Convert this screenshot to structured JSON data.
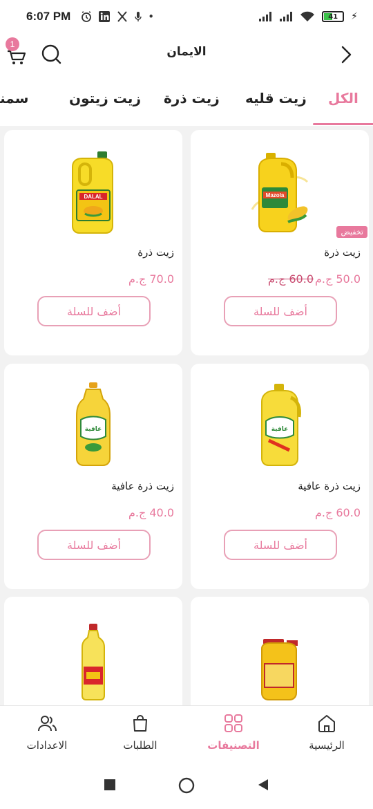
{
  "status_bar": {
    "time": "6:07 PM",
    "battery": "41",
    "left_icons": [
      "alarm-icon",
      "linkedin-icon",
      "restaurant-icon",
      "mic-icon",
      "dot-icon"
    ],
    "right_icons": [
      "signal-icon",
      "signal-icon",
      "wifi-icon",
      "battery-icon",
      "charging-icon"
    ]
  },
  "app_bar": {
    "title": "الايمان",
    "cart_count": "1"
  },
  "tabs": [
    {
      "label": "الكل",
      "active": true
    },
    {
      "label": "زيت قليه",
      "active": false
    },
    {
      "label": "زيت ذرة",
      "active": false
    },
    {
      "label": "زيت زيتون",
      "active": false
    },
    {
      "label": "سمنه",
      "active": false
    }
  ],
  "products": [
    {
      "name": "زيت ذرة",
      "price": "50.0 ج.م",
      "old_price": "60.0 ج.م",
      "badge": "تخفيض",
      "add_label": "أضف للسلة",
      "image": "mazola-bottle"
    },
    {
      "name": "زيت ذرة",
      "price": "70.0 ج.م",
      "add_label": "أضف للسلة",
      "image": "dalal-bottle"
    },
    {
      "name": "زيت ذرة عافية",
      "price": "60.0 ج.م",
      "add_label": "أضف للسلة",
      "image": "afia-bottle-large"
    },
    {
      "name": "زيت ذرة عافية",
      "price": "40.0 ج.م",
      "add_label": "أضف للسلة",
      "image": "afia-bottle-small"
    },
    {
      "name": "",
      "price": "",
      "add_label": "",
      "image": "oil-jug"
    },
    {
      "name": "",
      "price": "",
      "add_label": "",
      "image": "oil-tall-bottle"
    }
  ],
  "bottom_nav": [
    {
      "label": "الرئيسية",
      "icon": "home-icon",
      "active": false
    },
    {
      "label": "التصنيفات",
      "icon": "grid-icon",
      "active": true
    },
    {
      "label": "الطلبات",
      "icon": "bag-icon",
      "active": false
    },
    {
      "label": "الاعدادات",
      "icon": "users-icon",
      "active": false
    }
  ],
  "colors": {
    "accent": "#e8799d",
    "background": "#f2f2f2",
    "battery": "#3cc24a"
  }
}
